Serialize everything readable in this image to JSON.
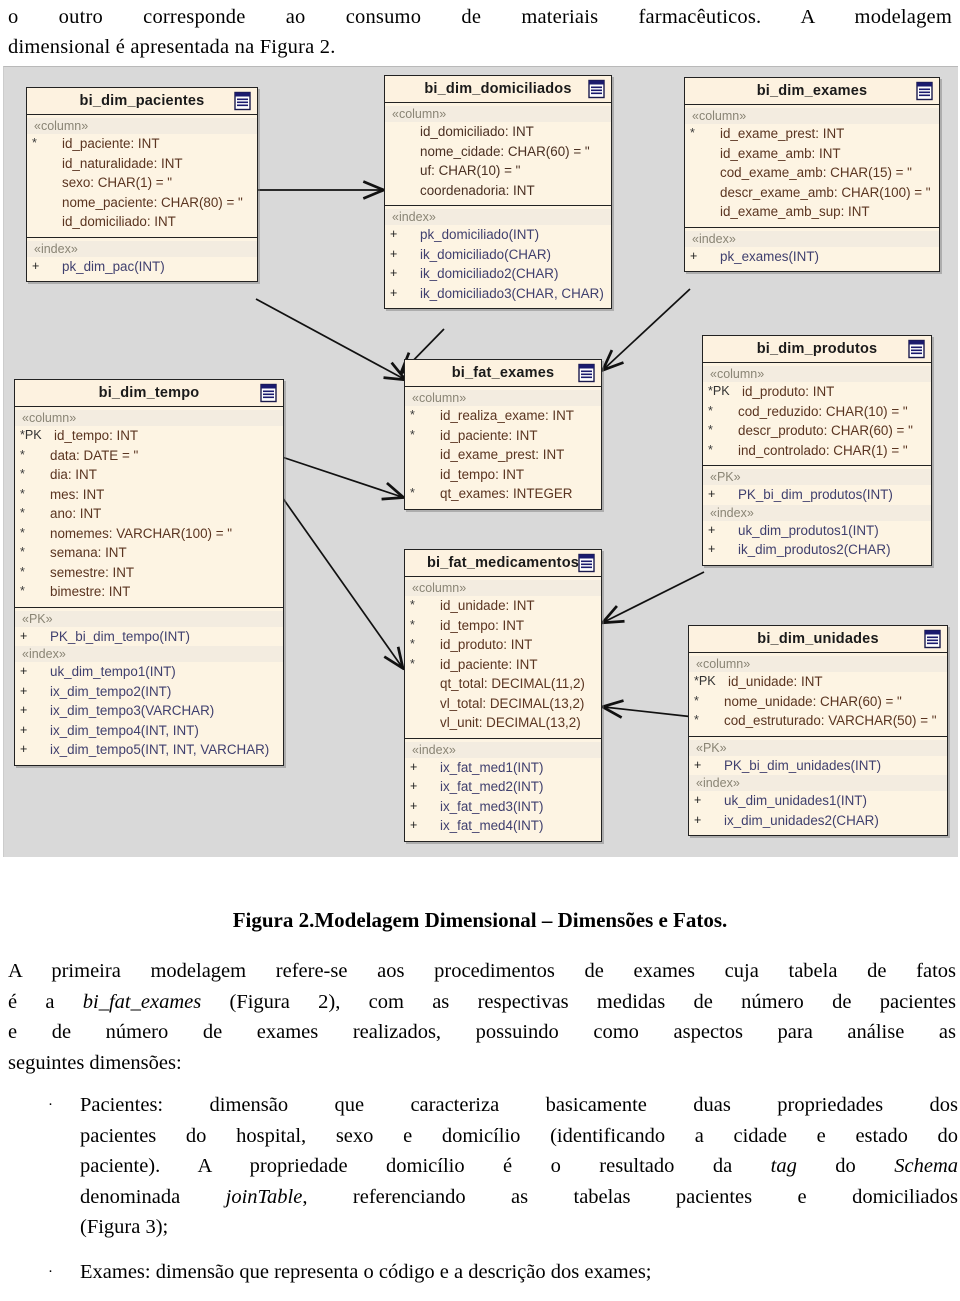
{
  "top_paragraph": {
    "line1": "o outro corresponde ao consumo de materiais farmacêuticos. A modelagem",
    "line2": "dimensional é apresentada na Figura 2."
  },
  "figure": {
    "caption": "Figura 2.Modelagem Dimensional –  Dimensões e Fatos.",
    "background_color": "#d9d9d9",
    "box_fill_color": "#fdf4e3",
    "box_border_color": "#222222",
    "column_text_color": "#5a3420",
    "index_text_color": "#3f3f6e",
    "icon_name": "table-icon",
    "tables": [
      {
        "name": "bi_dim_pacientes",
        "compartments": [
          {
            "stereotype": "«column»",
            "rows": [
              {
                "mark": "*",
                "text": "id_paciente: INT"
              },
              {
                "mark": "",
                "text": "id_naturalidade: INT"
              },
              {
                "mark": "",
                "text": "sexo: CHAR(1) = \""
              },
              {
                "mark": "",
                "text": "nome_paciente: CHAR(80) = \""
              },
              {
                "mark": "",
                "text": "id_domiciliado: INT"
              }
            ]
          },
          {
            "stereotype": "«index»",
            "rows": [
              {
                "mark": "+",
                "text": "pk_dim_pac(INT)"
              }
            ]
          }
        ]
      },
      {
        "name": "bi_dim_domiciliados",
        "compartments": [
          {
            "stereotype": "«column»",
            "rows": [
              {
                "mark": "",
                "text": "id_domiciliado: INT"
              },
              {
                "mark": "",
                "text": "nome_cidade: CHAR(60) = \""
              },
              {
                "mark": "",
                "text": "uf: CHAR(10) = \""
              },
              {
                "mark": "",
                "text": "coordenadoria: INT"
              }
            ]
          },
          {
            "stereotype": "«index»",
            "rows": [
              {
                "mark": "+",
                "text": "pk_domiciliado(INT)"
              },
              {
                "mark": "+",
                "text": "ik_domiciliado(CHAR)"
              },
              {
                "mark": "+",
                "text": "ik_domiciliado2(CHAR)"
              },
              {
                "mark": "+",
                "text": "ik_domiciliado3(CHAR, CHAR)"
              }
            ]
          }
        ]
      },
      {
        "name": "bi_dim_exames",
        "compartments": [
          {
            "stereotype": "«column»",
            "rows": [
              {
                "mark": "*",
                "text": "id_exame_prest: INT"
              },
              {
                "mark": "",
                "text": "id_exame_amb: INT"
              },
              {
                "mark": "",
                "text": "cod_exame_amb: CHAR(15) = \""
              },
              {
                "mark": "",
                "text": "descr_exame_amb: CHAR(100) = \""
              },
              {
                "mark": "",
                "text": "id_exame_amb_sup: INT"
              }
            ]
          },
          {
            "stereotype": "«index»",
            "rows": [
              {
                "mark": "+",
                "text": "pk_exames(INT)"
              }
            ]
          }
        ]
      },
      {
        "name": "bi_dim_tempo",
        "compartments": [
          {
            "stereotype": "«column»",
            "rows": [
              {
                "mark": "*PK",
                "text": "id_tempo: INT"
              },
              {
                "mark": "*",
                "text": "data: DATE = \""
              },
              {
                "mark": "*",
                "text": "dia: INT"
              },
              {
                "mark": "*",
                "text": "mes: INT"
              },
              {
                "mark": "*",
                "text": "ano: INT"
              },
              {
                "mark": "*",
                "text": "nomemes: VARCHAR(100) = \""
              },
              {
                "mark": "*",
                "text": "semana: INT"
              },
              {
                "mark": "*",
                "text": "semestre: INT"
              },
              {
                "mark": "*",
                "text": "bimestre: INT"
              }
            ]
          },
          {
            "stereotype": "«PK»",
            "rows": [
              {
                "mark": "+",
                "text": "PK_bi_dim_tempo(INT)"
              }
            ],
            "stereotype2": "«index»",
            "rows2": [
              {
                "mark": "+",
                "text": "uk_dim_tempo1(INT)"
              },
              {
                "mark": "+",
                "text": "ix_dim_tempo2(INT)"
              },
              {
                "mark": "+",
                "text": "ix_dim_tempo3(VARCHAR)"
              },
              {
                "mark": "+",
                "text": "ix_dim_tempo4(INT, INT)"
              },
              {
                "mark": "+",
                "text": "ix_dim_tempo5(INT, INT, VARCHAR)"
              }
            ]
          }
        ]
      },
      {
        "name": "bi_fat_exames",
        "compartments": [
          {
            "stereotype": "«column»",
            "rows": [
              {
                "mark": "*",
                "text": "id_realiza_exame: INT"
              },
              {
                "mark": "*",
                "text": "id_paciente: INT"
              },
              {
                "mark": "",
                "text": "id_exame_prest: INT"
              },
              {
                "mark": "",
                "text": "id_tempo: INT"
              },
              {
                "mark": "*",
                "text": "qt_exames: INTEGER"
              }
            ]
          }
        ]
      },
      {
        "name": "bi_fat_medicamentos",
        "compartments": [
          {
            "stereotype": "«column»",
            "rows": [
              {
                "mark": "*",
                "text": "id_unidade: INT"
              },
              {
                "mark": "*",
                "text": "id_tempo: INT"
              },
              {
                "mark": "*",
                "text": "id_produto: INT"
              },
              {
                "mark": "*",
                "text": "id_paciente: INT"
              },
              {
                "mark": "",
                "text": "qt_total: DECIMAL(11,2)"
              },
              {
                "mark": "",
                "text": "vl_total: DECIMAL(13,2)"
              },
              {
                "mark": "",
                "text": "vl_unit: DECIMAL(13,2)"
              }
            ]
          },
          {
            "stereotype": "«index»",
            "rows": [
              {
                "mark": "+",
                "text": "ix_fat_med1(INT)"
              },
              {
                "mark": "+",
                "text": "ix_fat_med2(INT)"
              },
              {
                "mark": "+",
                "text": "ix_fat_med3(INT)"
              },
              {
                "mark": "+",
                "text": "ix_fat_med4(INT)"
              }
            ]
          }
        ]
      },
      {
        "name": "bi_dim_produtos",
        "compartments": [
          {
            "stereotype": "«column»",
            "rows": [
              {
                "mark": "*PK",
                "text": "id_produto: INT"
              },
              {
                "mark": "*",
                "text": "cod_reduzido: CHAR(10) = \""
              },
              {
                "mark": "*",
                "text": "descr_produto: CHAR(60) = \""
              },
              {
                "mark": "*",
                "text": "ind_controlado: CHAR(1) = \""
              }
            ]
          },
          {
            "stereotype": "«PK»",
            "rows": [
              {
                "mark": "+",
                "text": "PK_bi_dim_produtos(INT)"
              }
            ],
            "stereotype2": "«index»",
            "rows2": [
              {
                "mark": "+",
                "text": "uk_dim_produtos1(INT)"
              },
              {
                "mark": "+",
                "text": "ik_dim_produtos2(CHAR)"
              }
            ]
          }
        ]
      },
      {
        "name": "bi_dim_unidades",
        "compartments": [
          {
            "stereotype": "«column»",
            "rows": [
              {
                "mark": "*PK",
                "text": "id_unidade: INT"
              },
              {
                "mark": "*",
                "text": "nome_unidade: CHAR(60) = \""
              },
              {
                "mark": "*",
                "text": "cod_estruturado: VARCHAR(50) = \""
              }
            ]
          },
          {
            "stereotype": "«PK»",
            "rows": [
              {
                "mark": "+",
                "text": "PK_bi_dim_unidades(INT)"
              }
            ],
            "stereotype2": "«index»",
            "rows2": [
              {
                "mark": "+",
                "text": "uk_dim_unidades1(INT)"
              },
              {
                "mark": "+",
                "text": "ix_dim_unidades2(CHAR)"
              }
            ]
          }
        ]
      }
    ]
  },
  "body": {
    "para1_l1": "A primeira modelagem refere-se aos procedimentos de exames cuja tabela de fatos",
    "para1_l2a": "é a ",
    "para1_l2i": "bi_fat_exames",
    "para1_l2b": " (Figura 2), com as respectivas medidas de número de pacientes",
    "para1_l3": "e de número de exames realizados, possuindo como aspectos para análise as",
    "para1_l4": "seguintes dimensões:"
  },
  "bullets": {
    "marker": "·",
    "item1": {
      "l1": "Pacientes: dimensão que caracteriza basicamente duas propriedades dos",
      "l2": "pacientes do hospital, sexo e domicílio (identificando a cidade e estado do",
      "l3a": "paciente). A propriedade domicílio é o resultado da ",
      "l3i": "tag",
      "l3b": " do ",
      "l3i2": "Schema",
      "l4a": "denominada ",
      "l4i": "joinTable",
      "l4b": ", referenciando as tabelas pacientes e domiciliados",
      "l5": "(Figura 3);"
    },
    "item2": {
      "l1": "Exames: dimensão que representa o código e a descrição dos exames;"
    }
  }
}
